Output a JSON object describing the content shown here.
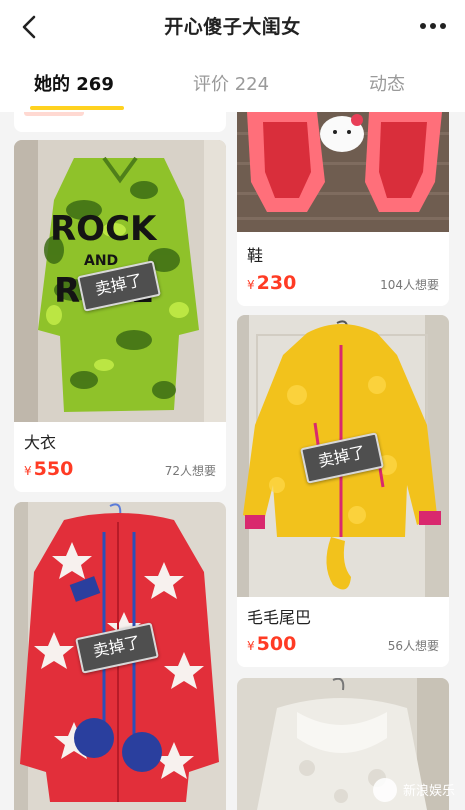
{
  "header": {
    "title": "开心傻子大闺女"
  },
  "tabs": [
    {
      "label": "她的 269"
    },
    {
      "label": "评价 224"
    },
    {
      "label": "动态"
    }
  ],
  "items": [
    {
      "name": "大衣",
      "currency": "¥",
      "price": "550",
      "wants": "72人想要",
      "status": "卖掉了"
    },
    {
      "name": "鞋",
      "currency": "¥",
      "price": "230",
      "wants": "104人想要"
    },
    {
      "name": "毛毛尾巴",
      "currency": "¥",
      "price": "500",
      "wants": "56人想要",
      "status": "卖掉了"
    },
    {
      "name": "",
      "status": "卖掉了"
    }
  ],
  "coat_print": {
    "line1": "ROCK",
    "line2": "AND",
    "line3": "ROLL"
  },
  "watermark": "新浪娱乐",
  "colors": {
    "accent": "#ffd21f",
    "price": "#ff3b24"
  }
}
